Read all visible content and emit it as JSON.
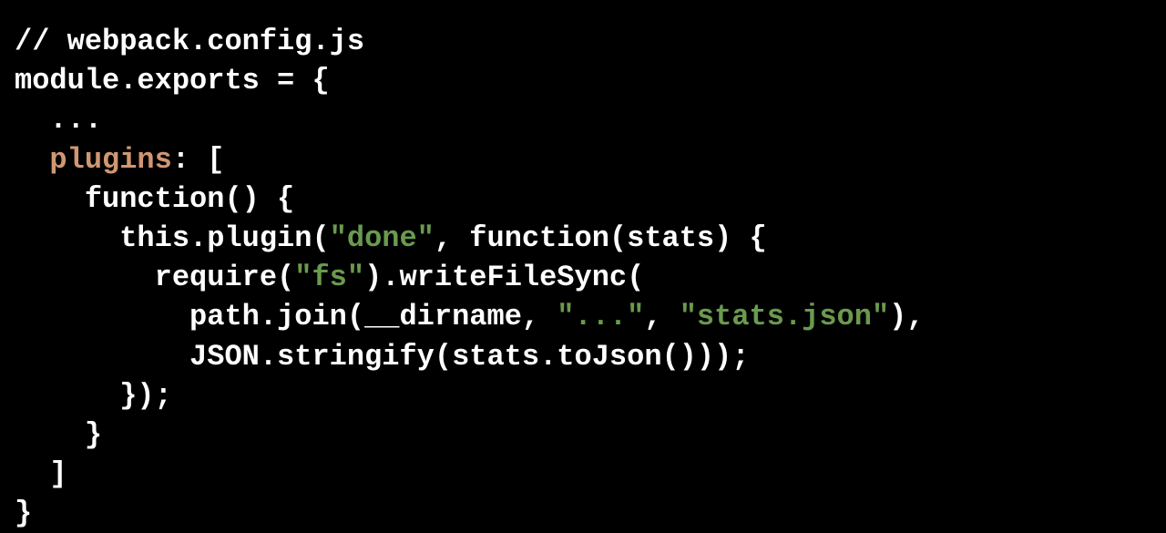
{
  "code": {
    "l1": "// webpack.config.js",
    "l2": "module.exports = {",
    "l3": "  ...",
    "l4a": "  ",
    "l4b": "plugins",
    "l4c": ": [",
    "l5": "    function() {",
    "l6a": "      this.plugin(",
    "l6b": "\"done\"",
    "l6c": ", function(stats) {",
    "l7a": "        require(",
    "l7b": "\"fs\"",
    "l7c": ").writeFileSync(",
    "l8a": "          path.join(__dirname, ",
    "l8b": "\"...\"",
    "l8c": ", ",
    "l8d": "\"stats.json\"",
    "l8e": "),",
    "l9": "          JSON.stringify(stats.toJson()));",
    "l10": "      });",
    "l11": "    }",
    "l12": "  ]",
    "l13": "}"
  }
}
